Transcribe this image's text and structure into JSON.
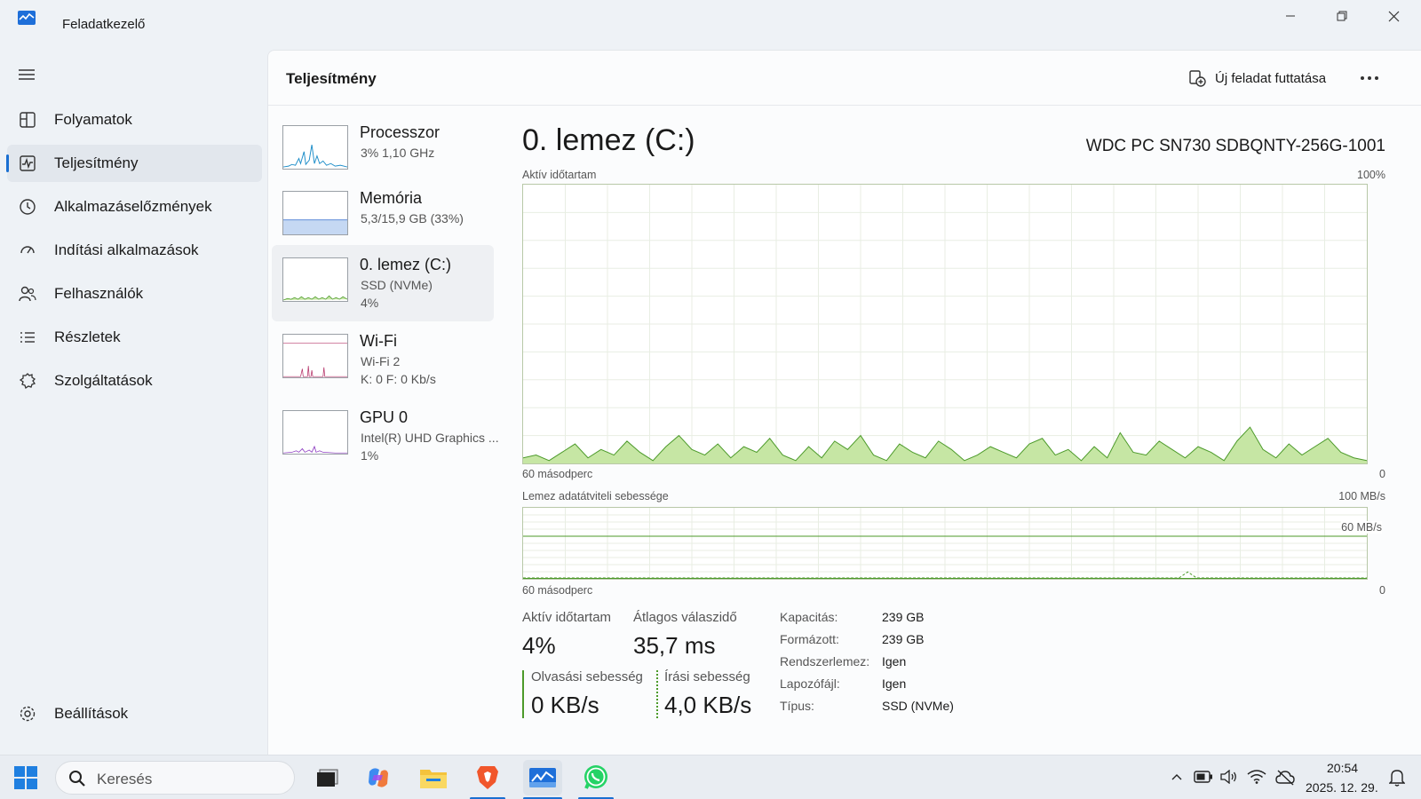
{
  "window": {
    "title": "Feladatkezelő"
  },
  "nav": {
    "items": [
      {
        "label": "Folyamatok",
        "icon": "processes-icon"
      },
      {
        "label": "Teljesítmény",
        "icon": "performance-icon",
        "active": true
      },
      {
        "label": "Alkalmazáselőzmények",
        "icon": "history-icon"
      },
      {
        "label": "Indítási alkalmazások",
        "icon": "startup-icon"
      },
      {
        "label": "Felhasználók",
        "icon": "users-icon"
      },
      {
        "label": "Részletek",
        "icon": "details-icon"
      },
      {
        "label": "Szolgáltatások",
        "icon": "services-icon"
      }
    ],
    "settings_label": "Beállítások"
  },
  "header": {
    "title": "Teljesítmény",
    "run_task_label": "Új feladat futtatása"
  },
  "devices": [
    {
      "name": "Processzor",
      "sub1": "3% 1,10 GHz",
      "sub2": "",
      "color": "#1e8ec9"
    },
    {
      "name": "Memória",
      "sub1": "5,3/15,9 GB (33%)",
      "sub2": "",
      "color": "#4a7fd4"
    },
    {
      "name": "0. lemez (C:)",
      "sub1": "SSD (NVMe)",
      "sub2": "4%",
      "color": "#4c9a2a",
      "selected": true
    },
    {
      "name": "Wi-Fi",
      "sub1": "Wi-Fi 2",
      "sub2": "K: 0 F: 0 Kb/s",
      "color": "#b83a6e"
    },
    {
      "name": "GPU 0",
      "sub1": "Intel(R) UHD Graphics ...",
      "sub2": "1%",
      "color": "#8e3ec2"
    }
  ],
  "detail": {
    "title": "0. lemez (C:)",
    "model": "WDC PC SN730 SDBQNTY-256G-1001",
    "graph1": {
      "label": "Aktív időtartam",
      "max_label": "100%",
      "x_left": "60 másodperc",
      "x_right": "0",
      "values": [
        2,
        3,
        1,
        4,
        7,
        2,
        5,
        3,
        8,
        4,
        1,
        6,
        10,
        5,
        3,
        7,
        2,
        6,
        4,
        9,
        3,
        1,
        6,
        2,
        8,
        5,
        10,
        3,
        1,
        7,
        4,
        2,
        8,
        5,
        1,
        3,
        6,
        4,
        2,
        7,
        9,
        3,
        5,
        1,
        6,
        2,
        11,
        4,
        3,
        8,
        5,
        2,
        6,
        4,
        1,
        8,
        13,
        5,
        2,
        7,
        3,
        6,
        9,
        4,
        2,
        1
      ]
    },
    "graph2": {
      "label": "Lemez adatátviteli sebessége",
      "max_label": "100 MB/s",
      "ref_label": "60 MB/s",
      "x_left": "60 másodperc",
      "x_right": "0"
    },
    "stats": {
      "active_label": "Aktív időtartam",
      "active_value": "4%",
      "response_label": "Átlagos válaszidő",
      "response_value": "35,7 ms",
      "read_label": "Olvasási sebesség",
      "read_value": "0 KB/s",
      "write_label": "Írási sebesség",
      "write_value": "4,0 KB/s"
    },
    "props": [
      {
        "label": "Kapacitás:",
        "value": "239 GB"
      },
      {
        "label": "Formázott:",
        "value": "239 GB"
      },
      {
        "label": "Rendszerlemez:",
        "value": "Igen"
      },
      {
        "label": "Lapozófájl:",
        "value": "Igen"
      },
      {
        "label": "Típus:",
        "value": "SSD (NVMe)"
      }
    ]
  },
  "taskbar": {
    "search_placeholder": "Keresés",
    "time": "20:54",
    "date": "2025. 12. 29.",
    "apps": [
      "task-view-icon",
      "copilot-icon",
      "file-explorer-icon",
      "brave-icon",
      "task-manager-icon",
      "whatsapp-icon"
    ]
  },
  "colors": {
    "accent": "#1a6fd1",
    "disk_green": "#4c9a2a",
    "disk_fill": "#c6e6a4"
  }
}
